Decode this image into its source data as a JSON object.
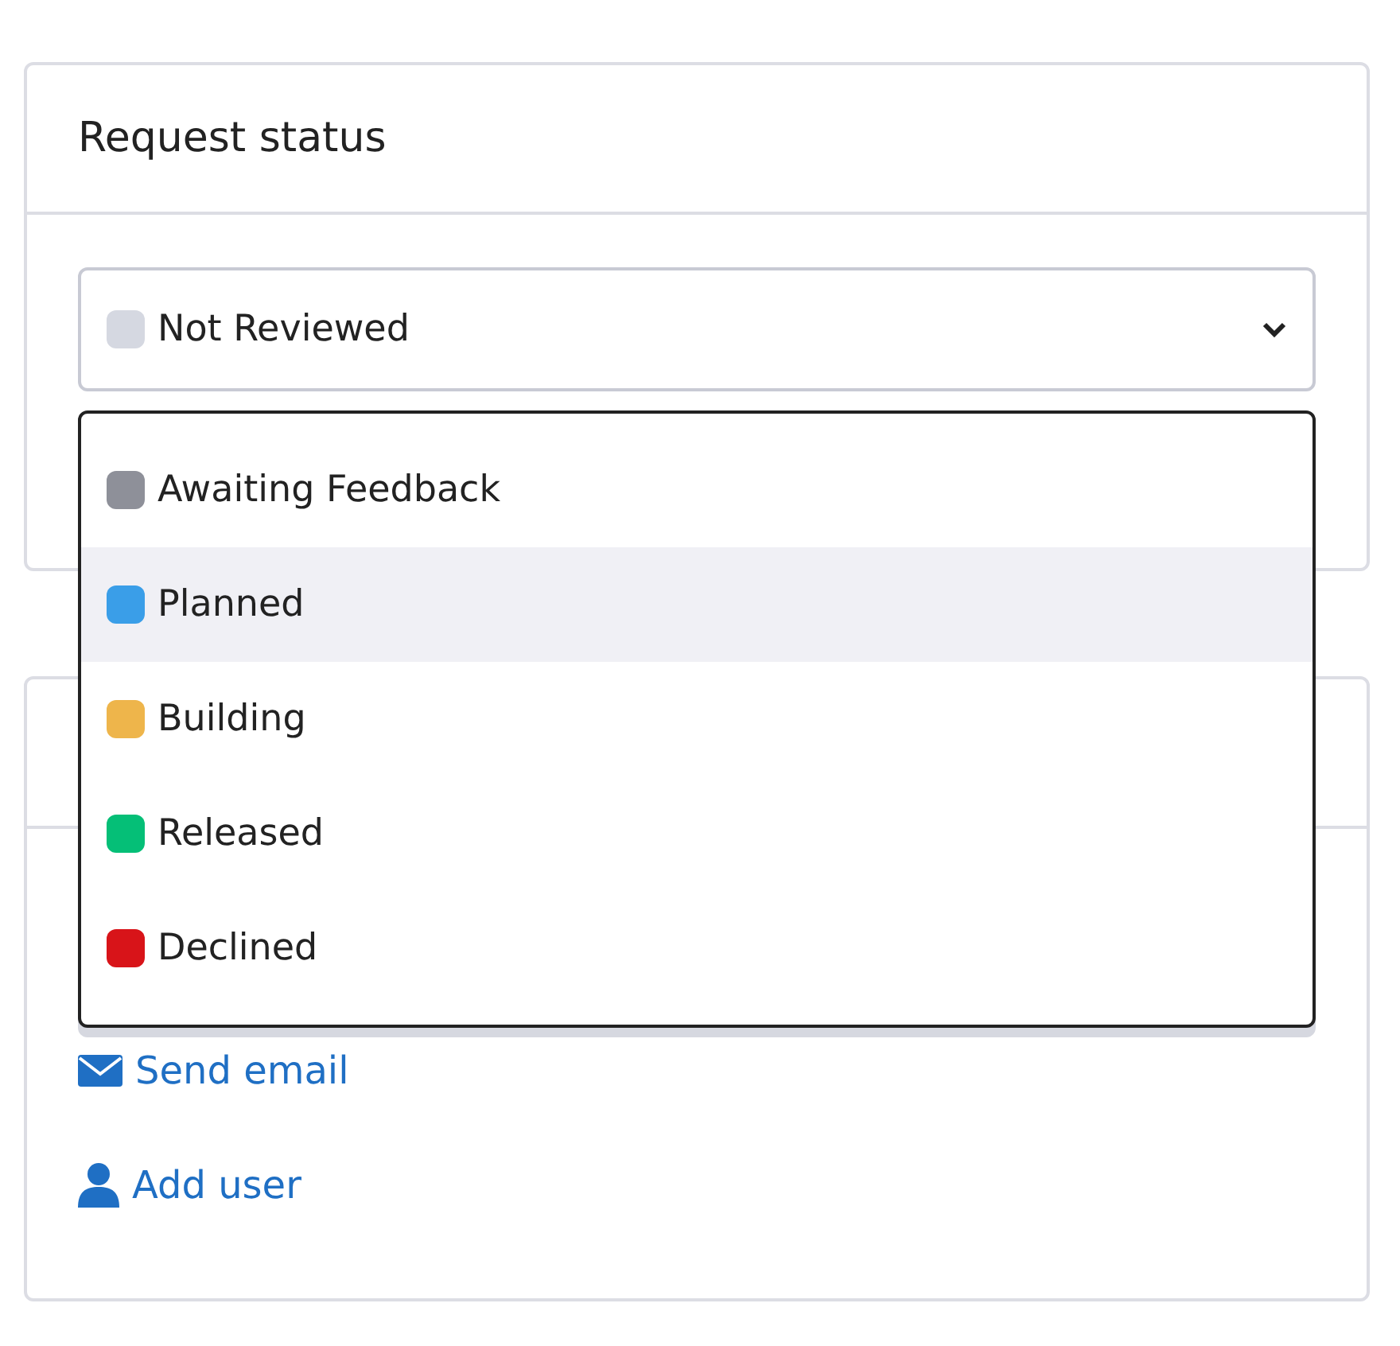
{
  "status_card": {
    "title": "Request status",
    "select": {
      "value": "Not Reviewed",
      "color": "#d5d8e1",
      "expanded": true
    },
    "options": [
      {
        "label": "Awaiting Feedback",
        "color": "#8e9099",
        "selected": false
      },
      {
        "label": "Planned",
        "color": "#3a9ee8",
        "selected": true
      },
      {
        "label": "Building",
        "color": "#eeb54b",
        "selected": false
      },
      {
        "label": "Released",
        "color": "#05bf77",
        "selected": false
      },
      {
        "label": "Declined",
        "color": "#d81419",
        "selected": false
      }
    ]
  },
  "actions_card": {
    "links": [
      {
        "kind": "email",
        "label": "Send email"
      },
      {
        "kind": "user",
        "label": "Add user"
      }
    ]
  }
}
